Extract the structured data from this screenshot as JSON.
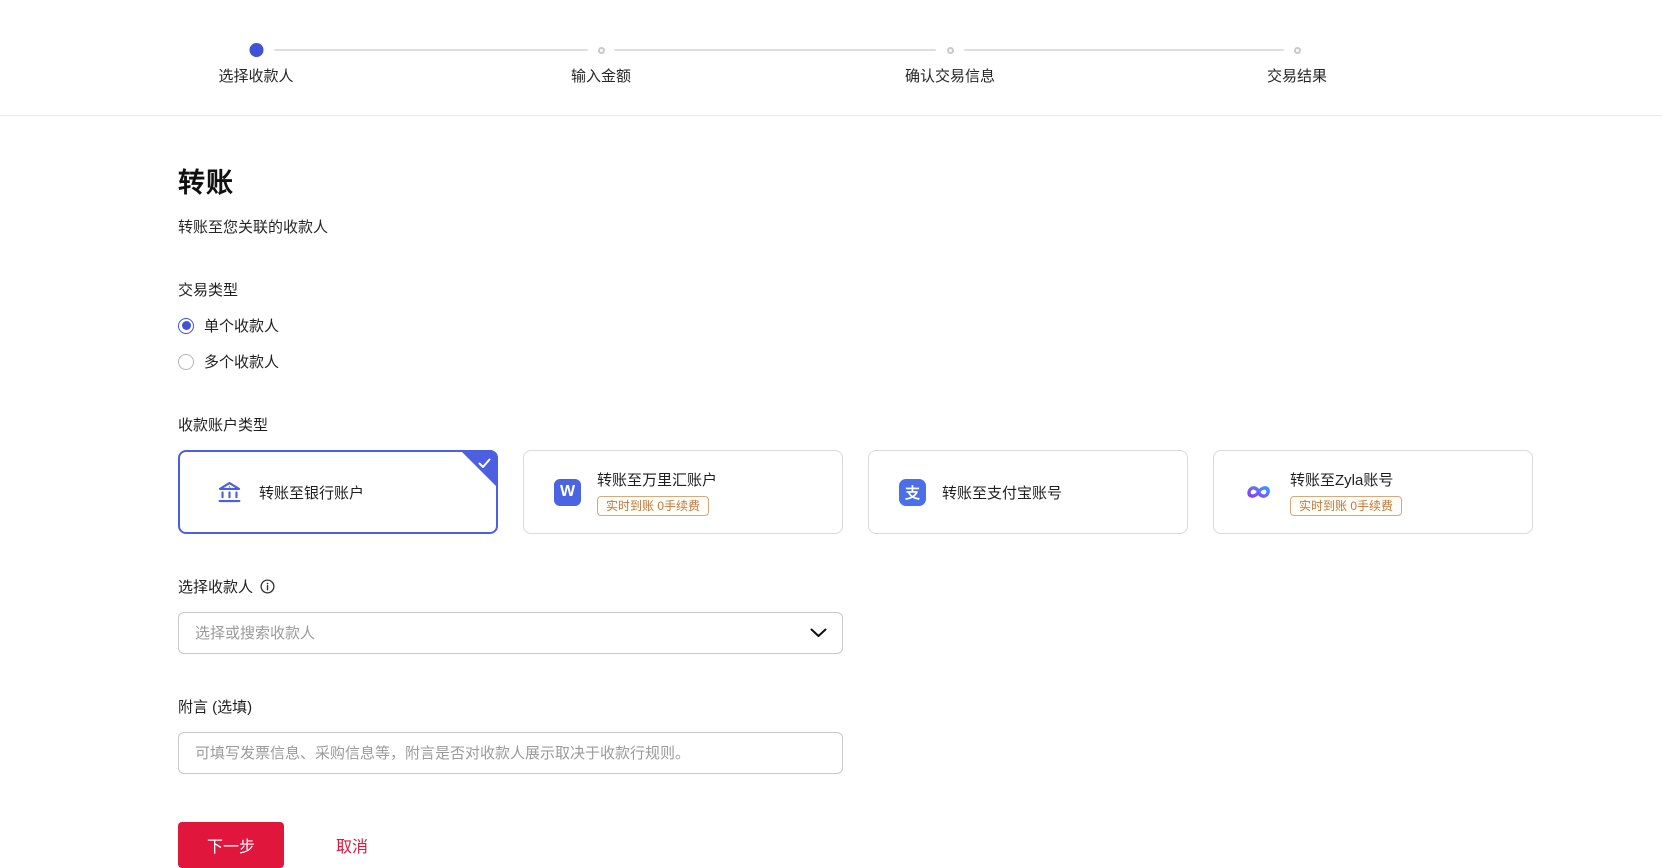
{
  "stepper": {
    "steps": [
      {
        "label": "选择收款人",
        "active": true
      },
      {
        "label": "输入金额",
        "active": false
      },
      {
        "label": "确认交易信息",
        "active": false
      },
      {
        "label": "交易结果",
        "active": false
      }
    ]
  },
  "page": {
    "title": "转账",
    "subtitle": "转账至您关联的收款人"
  },
  "transaction_type": {
    "label": "交易类型",
    "options": [
      {
        "label": "单个收款人",
        "selected": true
      },
      {
        "label": "多个收款人",
        "selected": false
      }
    ]
  },
  "account_type": {
    "label": "收款账户类型",
    "cards": [
      {
        "title": "转账至银行账户",
        "icon": "bank-icon",
        "selected": true,
        "badge": ""
      },
      {
        "title": "转账至万里汇账户",
        "icon": "worldfirst-icon",
        "selected": false,
        "badge": "实时到账 0手续费"
      },
      {
        "title": "转账至支付宝账号",
        "icon": "alipay-icon",
        "selected": false,
        "badge": ""
      },
      {
        "title": "转账至Zyla账号",
        "icon": "zyla-icon",
        "selected": false,
        "badge": "实时到账 0手续费"
      }
    ]
  },
  "icons": {
    "worldfirst_glyph": "W",
    "alipay_glyph": "支"
  },
  "payee": {
    "label": "选择收款人",
    "placeholder": "选择或搜索收款人"
  },
  "memo": {
    "label": "附言 (选填)",
    "placeholder": "可填写发票信息、采购信息等，附言是否对收款人展示取决于收款行规则。"
  },
  "actions": {
    "next": "下一步",
    "cancel": "取消"
  },
  "colors": {
    "accent_blue": "#4152d9",
    "card_border_blue": "#4c5fe0",
    "brand_red": "#e0163c",
    "badge_orange": "#c2773a"
  }
}
